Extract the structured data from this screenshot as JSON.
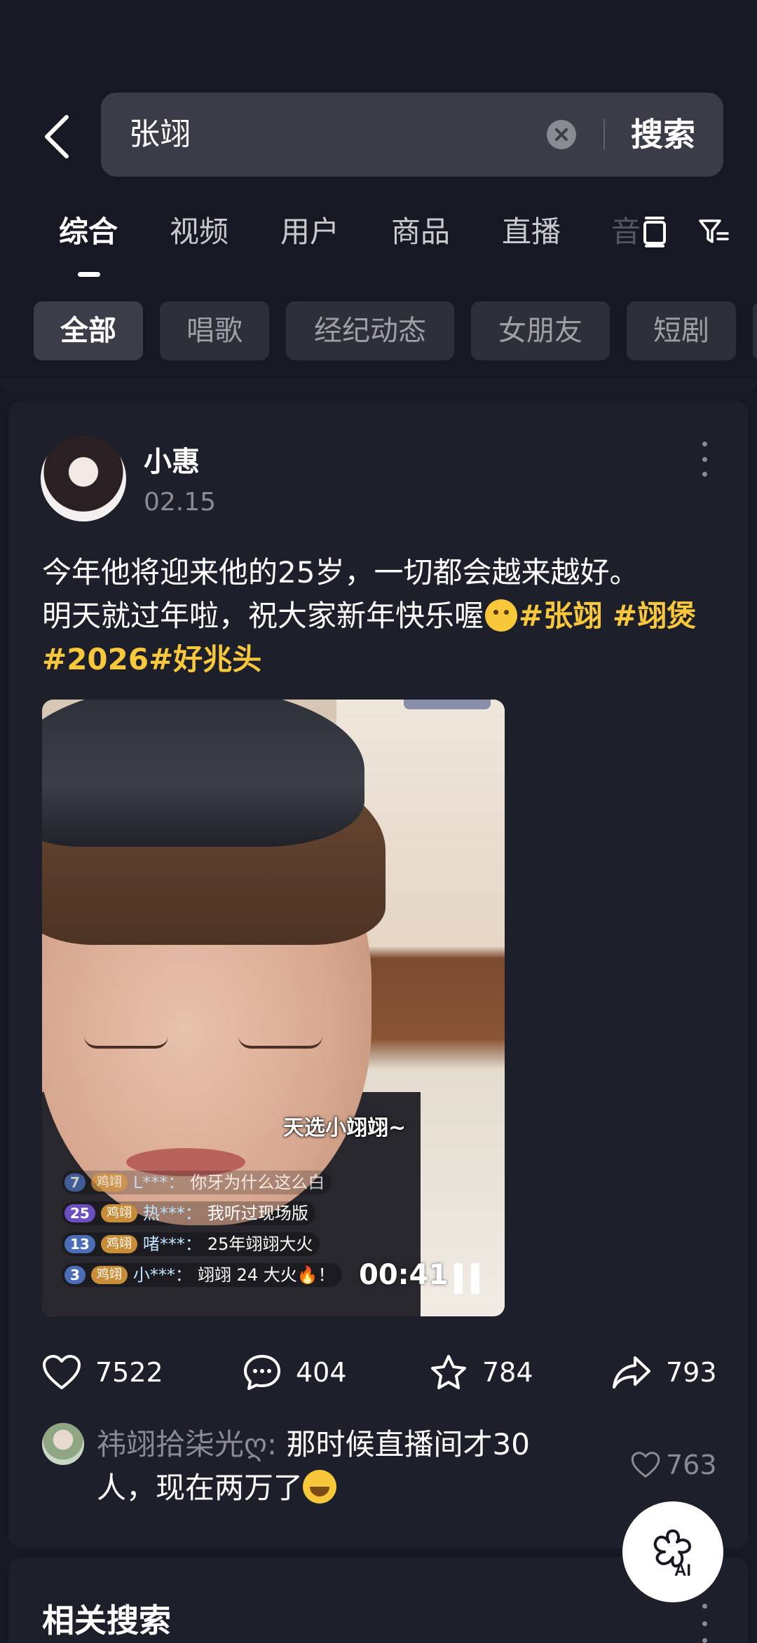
{
  "search": {
    "query": "张翊",
    "submit_label": "搜索"
  },
  "tabs": [
    {
      "label": "综合",
      "active": true
    },
    {
      "label": "视频"
    },
    {
      "label": "用户"
    },
    {
      "label": "商品"
    },
    {
      "label": "直播"
    }
  ],
  "chips": [
    {
      "label": "全部",
      "active": true
    },
    {
      "label": "唱歌"
    },
    {
      "label": "经纪动态"
    },
    {
      "label": "女朋友"
    },
    {
      "label": "短剧"
    }
  ],
  "post": {
    "author": "小惠",
    "date": "02.15",
    "text_line1": "今年他将迎来他的25岁，一切都会越来越好。",
    "text_line2": "明天就过年啦，祝大家新年快乐喔",
    "hashtags": "#张翊 #翊煲#2026#好兆头",
    "video": {
      "caption": "天选小翊翊~",
      "time": "00:41",
      "chat": [
        {
          "level": "7",
          "badge": "鸡翊",
          "user": "L***：",
          "text": "你牙为什么这么白"
        },
        {
          "level": "25",
          "badge": "鸡翊",
          "user": "热***：",
          "text": "我听过现场版"
        },
        {
          "level": "13",
          "badge": "鸡翊",
          "user": "啫***：",
          "text": "25年翊翊大火"
        },
        {
          "level": "3",
          "badge": "鸡翊",
          "user": "小***：",
          "text": "翊翊 24 大火🔥！"
        }
      ]
    },
    "stats": {
      "likes": "7522",
      "comments": "404",
      "favorites": "784",
      "shares": "793"
    },
    "top_comment": {
      "user": "祎翊拾柒光ღ:",
      "text": "那时候直播间才30人，现在两万了",
      "likes": "763"
    }
  },
  "ai_button_label": "AI",
  "related": {
    "title": "相关搜索"
  },
  "colors": {
    "background": "#161823",
    "card": "#1d1f2b",
    "hashtag": "#f8c73a",
    "muted": "#8b8c93"
  }
}
